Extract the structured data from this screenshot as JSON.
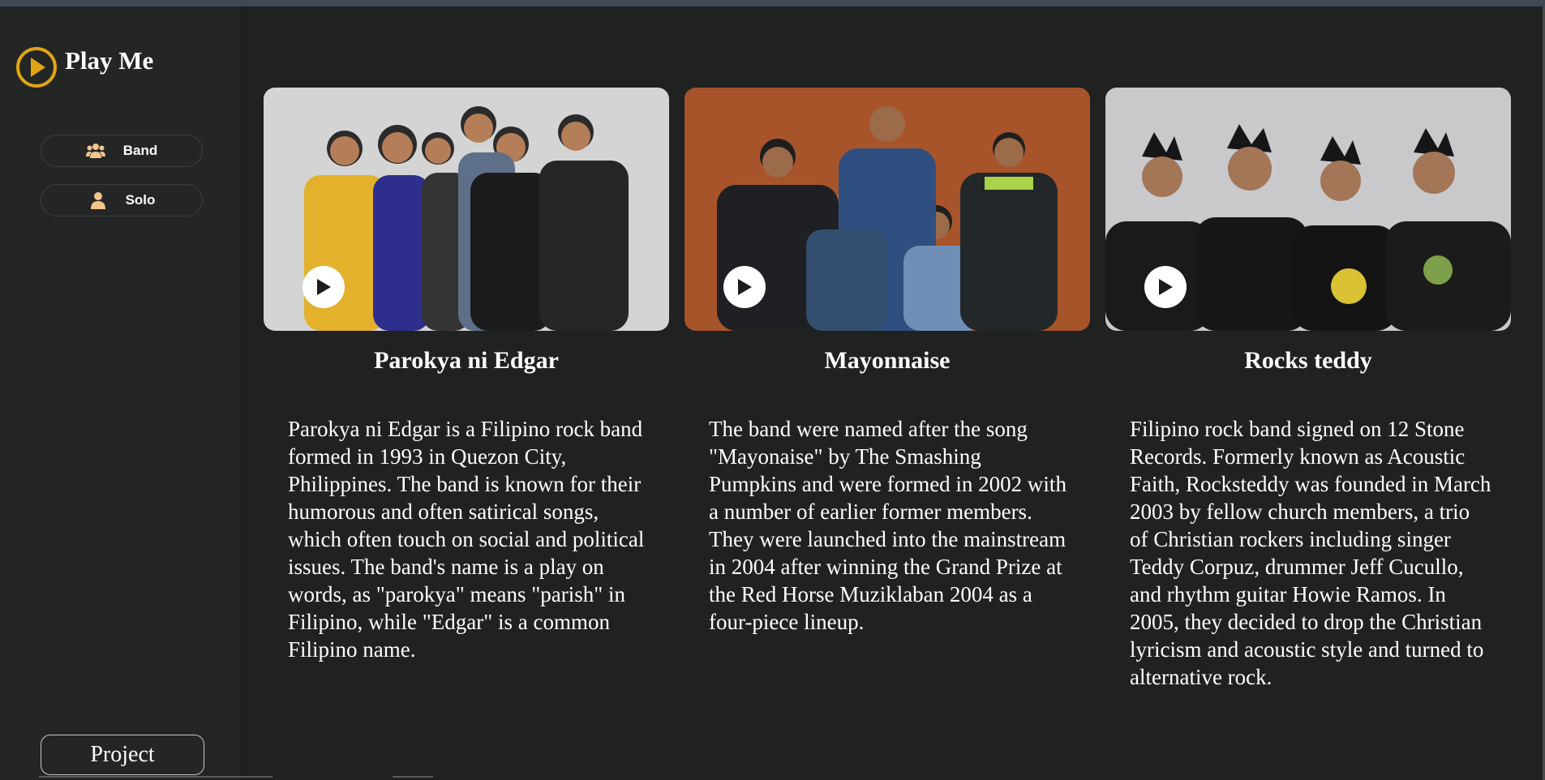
{
  "app": {
    "title": "Play Me",
    "accent_color": "#e0a514",
    "icon": "play-circle-icon"
  },
  "nav": {
    "items": [
      {
        "label": "Band",
        "icon": "users-icon"
      },
      {
        "label": "Solo",
        "icon": "user-icon"
      }
    ],
    "project_label": "Project"
  },
  "cards": [
    {
      "title": "Parokya ni Edgar",
      "description": "Parokya ni Edgar is a Filipino rock band formed in 1993 in Quezon City, Philippines. The band is known for their humorous and often satirical songs, which often touch on social and political issues. The band's name is a play on words, as \"parokya\" means \"parish\" in Filipino, while \"Edgar\" is a common Filipino name.",
      "image_bg": "#d4d4d4"
    },
    {
      "title": "Mayonnaise",
      "description": "The band were named after the song \"Mayonaise\" by The Smashing Pumpkins and were formed in 2002 with a number of earlier former members. They were launched into the mainstream in 2004 after winning the Grand Prize at the Red Horse Muziklaban 2004 as a four-piece lineup.",
      "image_bg": "#a8542a"
    },
    {
      "title": "Rocks teddy",
      "description": "Filipino rock band signed on 12 Stone Records. Formerly known as Acoustic Faith, Rocksteddy was founded in March 2003 by fellow church members, a trio of Christian rockers including singer Teddy Corpuz, drummer Jeff Cucullo, and rhythm guitar Howie Ramos. In 2005, they decided to drop the Christian lyricism and acoustic style and turned to alternative rock.",
      "image_bg": "#c9c9cc"
    }
  ]
}
